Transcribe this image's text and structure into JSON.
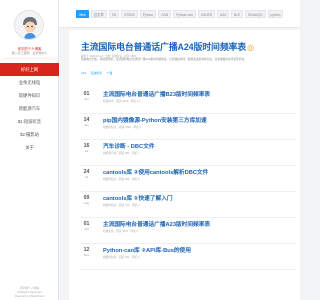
{
  "sidebar": {
    "site_name": "孫宇的个人博客",
    "site_desc": "嵌入式工程师 · 爱折腾的人",
    "nav": [
      {
        "label": "好好上网",
        "active": true
      },
      {
        "label": "业余无线电",
        "active": false
      },
      {
        "label": "软硬件知识",
        "active": false
      },
      {
        "label": "新能源汽车",
        "active": false
      },
      {
        "label": "$1:短波听音",
        "active": false
      },
      {
        "label": "$2:摄影站",
        "active": false
      },
      {
        "label": "关于",
        "active": false
      }
    ],
    "footer": [
      "孙宇的个人博客",
      "All Rights Reserved",
      "Powered by WordPress"
    ]
  },
  "topbar": {
    "tags": [
      {
        "label": "Web",
        "active": true
      },
      {
        "label": "旧文章",
        "active": false
      },
      {
        "label": "SN",
        "active": false
      },
      {
        "label": "STM32",
        "active": false
      },
      {
        "label": "Python",
        "active": false
      },
      {
        "label": "CAN",
        "active": false
      },
      {
        "label": "Python-can",
        "active": false
      },
      {
        "label": "CANFD",
        "active": false
      },
      {
        "label": "A24",
        "active": false
      },
      {
        "label": "BLE",
        "active": false
      },
      {
        "label": "BDAUQG",
        "active": false
      },
      {
        "label": "python",
        "active": false
      }
    ]
  },
  "post": {
    "title": "主流国际电台普通话广播A24版时间频率表",
    "title_icon": "◎",
    "meta": "发布于 2023-05-12 · 分类: 短波听音 · 阅读 1832",
    "intro": "短波电台列表，持续更新中。主流国际电台普通话广播A24版时间频率表，包含播出时间、频率及发射地等信息，欢迎收藏并在评论区补充。",
    "tags": [
      "A24",
      "短波听音",
      "广播"
    ]
  },
  "articles": [
    {
      "day": "01",
      "month": "Jun",
      "title": "主流国际电台普通话广播B23版时间频率表",
      "meta": "短波听音 · 阅读 2014 · 评论 12"
    },
    {
      "day": "14",
      "month": "Jun",
      "title": "pip国内镜像源-Python安装第三方库加速",
      "meta": "软硬件知识 · 阅读 1520 · 评论 3"
    },
    {
      "day": "16",
      "month": "Jul",
      "title": "汽车诊断 - DBC文件",
      "meta": "新能源汽车 · 阅读 987 · 评论 1"
    },
    {
      "day": "24",
      "month": "Jul",
      "title": "cantools库 ②使用cantools解析DBC文件",
      "meta": "软硬件知识 · 阅读 866 · 评论 0"
    },
    {
      "day": "09",
      "month": "Aug",
      "title": "cantools库 ①快速了解入门",
      "meta": "软硬件知识 · 阅读 743 · 评论 2"
    },
    {
      "day": "01",
      "month": "Oct",
      "title": "主流国际电台普通话广播A23版时间频率表",
      "meta": "短波听音 · 阅读 1311 · 评论 5"
    },
    {
      "day": "12",
      "month": "Nov",
      "title": "Python-can库 ②API库-Bus的使用",
      "meta": "软硬件知识 · 阅读 654 · 评论 0"
    }
  ]
}
